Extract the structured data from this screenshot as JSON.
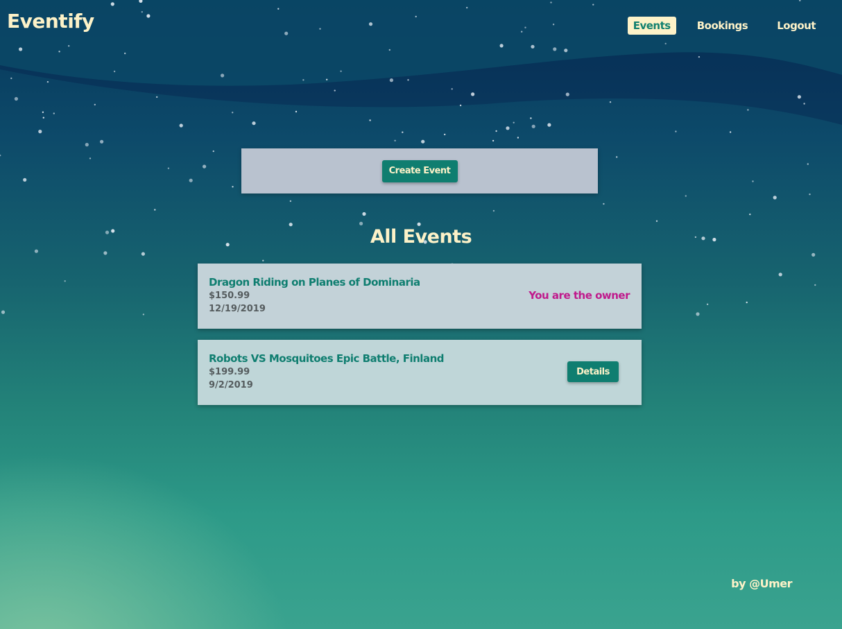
{
  "app": {
    "title": "Eventify"
  },
  "nav": {
    "items": [
      {
        "label": "Events",
        "active": true
      },
      {
        "label": "Bookings",
        "active": false
      },
      {
        "label": "Logout",
        "active": false
      }
    ]
  },
  "create": {
    "button_label": "Create Event"
  },
  "events_section": {
    "title": "All Events"
  },
  "events": [
    {
      "title": "Dragon Riding on Planes of Dominaria",
      "price": "$150.99",
      "date": "12/19/2019",
      "status": "You are the owner"
    },
    {
      "title": "Robots VS Mosquitoes Epic Battle, Finland",
      "price": "$199.99",
      "date": "9/2/2019",
      "action_label": "Details"
    }
  ],
  "footer": {
    "credit": "by @Umer"
  },
  "colors": {
    "accent": "#0f7e70",
    "cream": "#fdf2c8",
    "owner": "#c01a8c",
    "card": "#c3d2d8"
  }
}
